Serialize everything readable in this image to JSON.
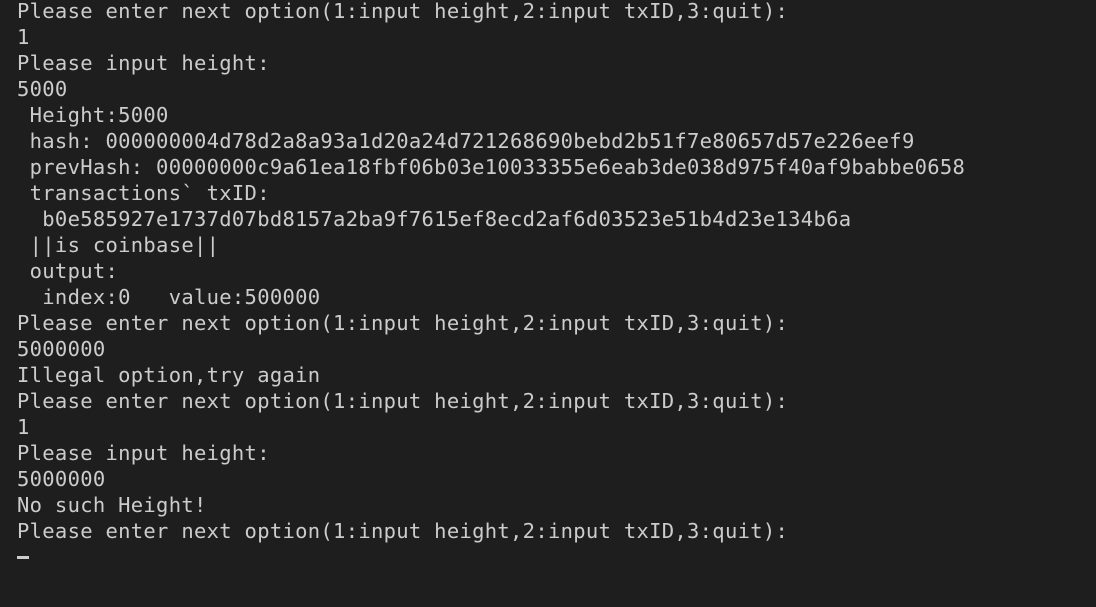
{
  "terminal": {
    "lines": [
      "Please enter next option(1:input height,2:input txID,3:quit):",
      "1",
      "Please input height:",
      "5000",
      " Height:5000",
      " hash: 000000004d78d2a8a93a1d20a24d721268690bebd2b51f7e80657d57e226eef9",
      " prevHash: 00000000c9a61ea18fbf06b03e10033355e6eab3de038d975f40af9babbe0658",
      " transactions` txID:",
      "  b0e585927e1737d07bd8157a2ba9f7615ef8ecd2af6d03523e51b4d23e134b6a",
      " ||is coinbase||",
      " output:",
      "  index:0   value:500000",
      "Please enter next option(1:input height,2:input txID,3:quit):",
      "5000000",
      "Illegal option,try again",
      "Please enter next option(1:input height,2:input txID,3:quit):",
      "1",
      "Please input height:",
      "5000000",
      "No such Height!",
      "Please enter next option(1:input height,2:input txID,3:quit):"
    ]
  }
}
